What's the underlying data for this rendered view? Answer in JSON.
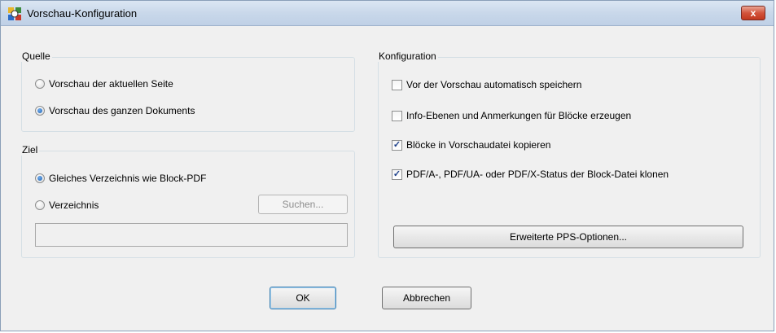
{
  "window": {
    "title": "Vorschau-Konfiguration",
    "close_label": "x"
  },
  "quelle": {
    "label": "Quelle",
    "options": [
      {
        "label": "Vorschau der aktuellen Seite",
        "checked": false
      },
      {
        "label": "Vorschau des ganzen Dokuments",
        "checked": true
      }
    ]
  },
  "ziel": {
    "label": "Ziel",
    "options": [
      {
        "label": "Gleiches Verzeichnis wie Block-PDF",
        "checked": true
      },
      {
        "label": "Verzeichnis",
        "checked": false
      }
    ],
    "search_label": "Suchen...",
    "path_value": ""
  },
  "konfiguration": {
    "label": "Konfiguration",
    "options": [
      {
        "label": "Vor der Vorschau automatisch speichern",
        "checked": false
      },
      {
        "label": "Info-Ebenen und Anmerkungen für Blöcke erzeugen",
        "checked": false
      },
      {
        "label": "Blöcke in Vorschaudatei kopieren",
        "checked": true
      },
      {
        "label": "PDF/A-, PDF/UA- oder PDF/X-Status der Block-Datei klonen",
        "checked": true
      }
    ],
    "advanced_label": "Erweiterte PPS-Optionen..."
  },
  "buttons": {
    "ok": "OK",
    "cancel": "Abbrechen"
  },
  "check_mark": "✓"
}
